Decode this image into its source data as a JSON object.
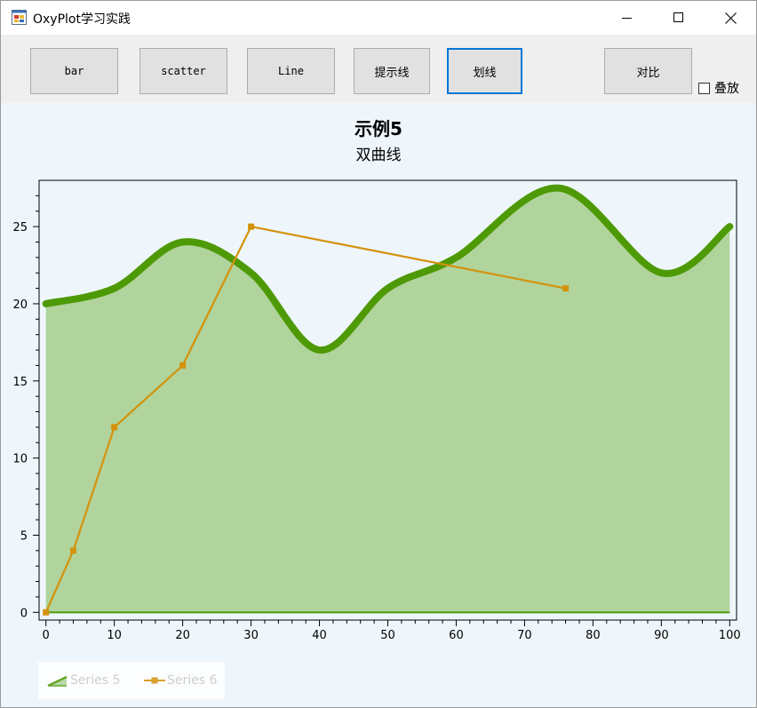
{
  "window": {
    "title": "OxyPlot学习实践",
    "icon": "app-form-icon",
    "controls": [
      "minimize-icon",
      "maximize-icon",
      "close-icon"
    ]
  },
  "toolbar": {
    "bar_label": "bar",
    "scatter_label": "scatter",
    "line_label": "Line",
    "tip_line_label": "提示线",
    "draw_line_label": "划线",
    "compare_label": "对比",
    "overlay_label": "叠放",
    "overlay_checked": false
  },
  "plot": {
    "title": "示例5",
    "subtitle": "双曲线",
    "background": "#eef6fc"
  },
  "chart_data": {
    "type": "line",
    "title": "示例5",
    "subtitle": "双曲线",
    "xlabel": "",
    "ylabel": "",
    "xlim": [
      -1,
      101
    ],
    "ylim": [
      -0.5,
      28
    ],
    "x_ticks": [
      0,
      10,
      20,
      30,
      40,
      50,
      60,
      70,
      80,
      90,
      100
    ],
    "y_ticks": [
      0,
      5,
      10,
      15,
      20,
      25
    ],
    "x_tick_labels": [
      "0",
      "10",
      "20",
      "30",
      "40",
      "50",
      "60",
      "70",
      "80",
      "90",
      "100"
    ],
    "y_tick_labels": [
      "0",
      "5",
      "10",
      "15",
      "20",
      "25"
    ],
    "legend_position": "bottom-left",
    "series": [
      {
        "name": "Series 5",
        "type": "area",
        "smooth": true,
        "color": "#4e9a06",
        "fill": "#b0d49c",
        "x": [
          0,
          10,
          20,
          30,
          40,
          50,
          60,
          75,
          90,
          100
        ],
        "values": [
          20,
          21,
          24,
          22,
          17,
          21,
          23,
          27.5,
          22,
          25
        ]
      },
      {
        "name": "Series 6",
        "type": "line",
        "marker": "square",
        "color": "#d4920c",
        "x": [
          0,
          4,
          10,
          20,
          30,
          76
        ],
        "values": [
          0,
          4,
          12,
          16,
          25,
          21
        ]
      }
    ]
  }
}
